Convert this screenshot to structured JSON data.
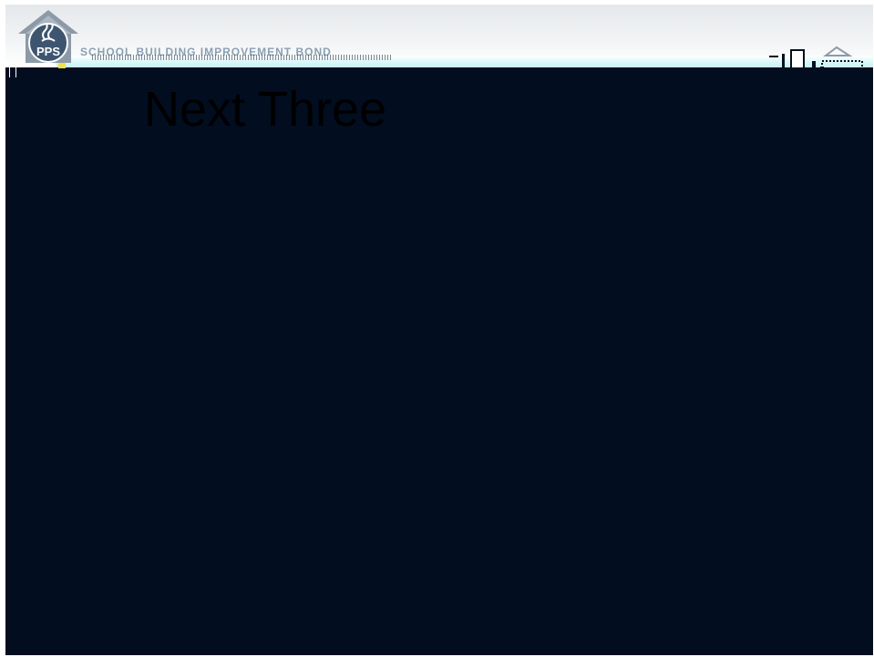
{
  "header": {
    "logo_text": "PPS",
    "bond_title": "SCHOOL BUILDING IMPROVEMENT BOND"
  },
  "slide": {
    "heading": "Next Three"
  },
  "colors": {
    "slide_background": "#020d20",
    "header_background": "#eef0f2",
    "title_text": "#000000",
    "bond_title_text": "#8aa0b4",
    "logo_roof": "#8c9aa8",
    "logo_disk": "#3e5570",
    "accent_yellow": "#f2e04a"
  },
  "icons": [
    "pps-logo-icon",
    "flame-icon",
    "schoolhouse-icon"
  ]
}
